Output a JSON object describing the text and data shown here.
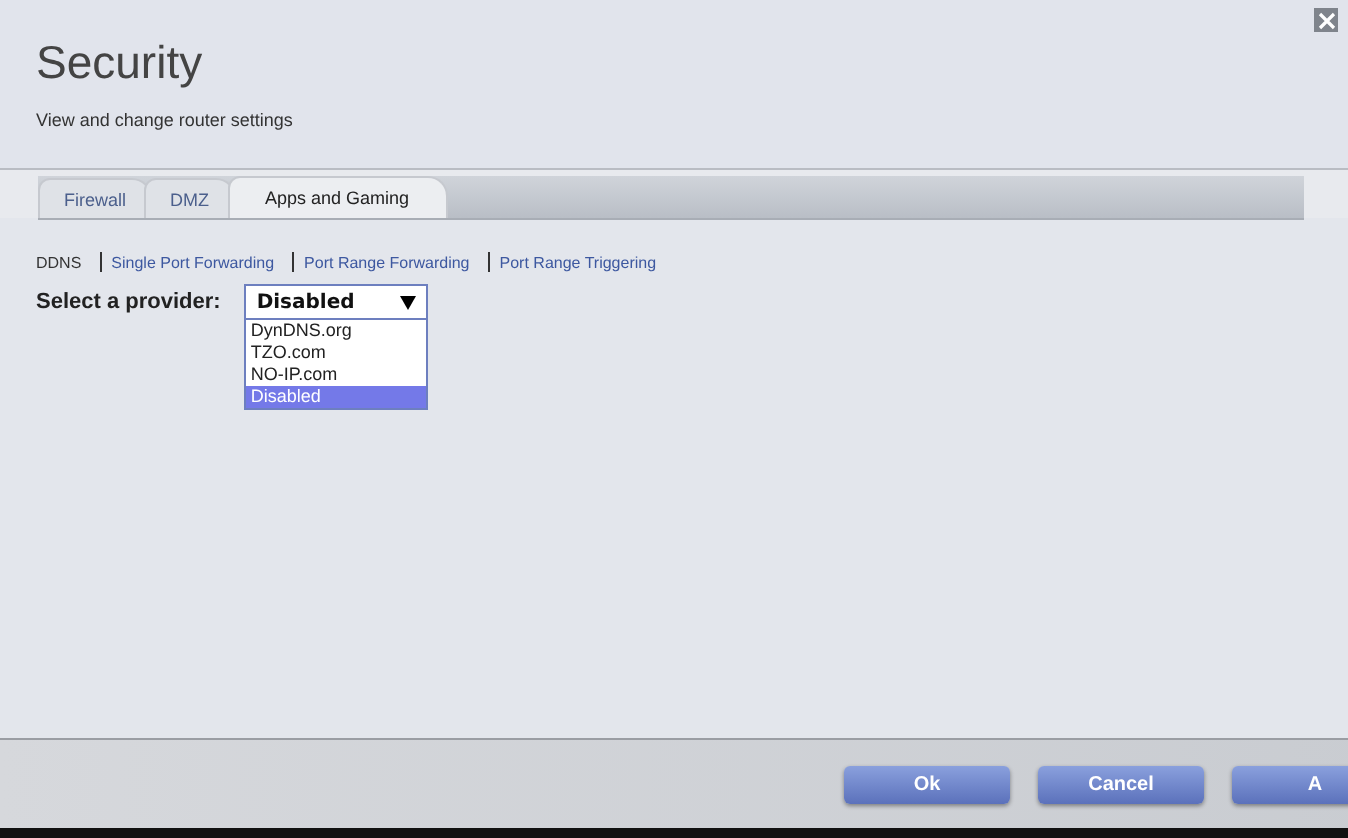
{
  "header": {
    "title": "Security",
    "subtitle": "View and change router settings"
  },
  "tabs": [
    {
      "label": "Firewall",
      "selected": false
    },
    {
      "label": "DMZ",
      "selected": false
    },
    {
      "label": "Apps and Gaming",
      "selected": true
    }
  ],
  "subnav": [
    {
      "label": "DDNS",
      "selected": true
    },
    {
      "label": "Single Port Forwarding",
      "selected": false
    },
    {
      "label": "Port Range Forwarding",
      "selected": false
    },
    {
      "label": "Port Range Triggering",
      "selected": false
    }
  ],
  "provider": {
    "label": "Select a provider:",
    "value": "Disabled",
    "expanded": true,
    "options": [
      {
        "label": "DynDNS.org",
        "selected": false
      },
      {
        "label": "TZO.com",
        "selected": false
      },
      {
        "label": "NO-IP.com",
        "selected": false
      },
      {
        "label": "Disabled",
        "selected": true
      }
    ]
  },
  "buttons": [
    "Ok",
    "Cancel",
    "A"
  ]
}
